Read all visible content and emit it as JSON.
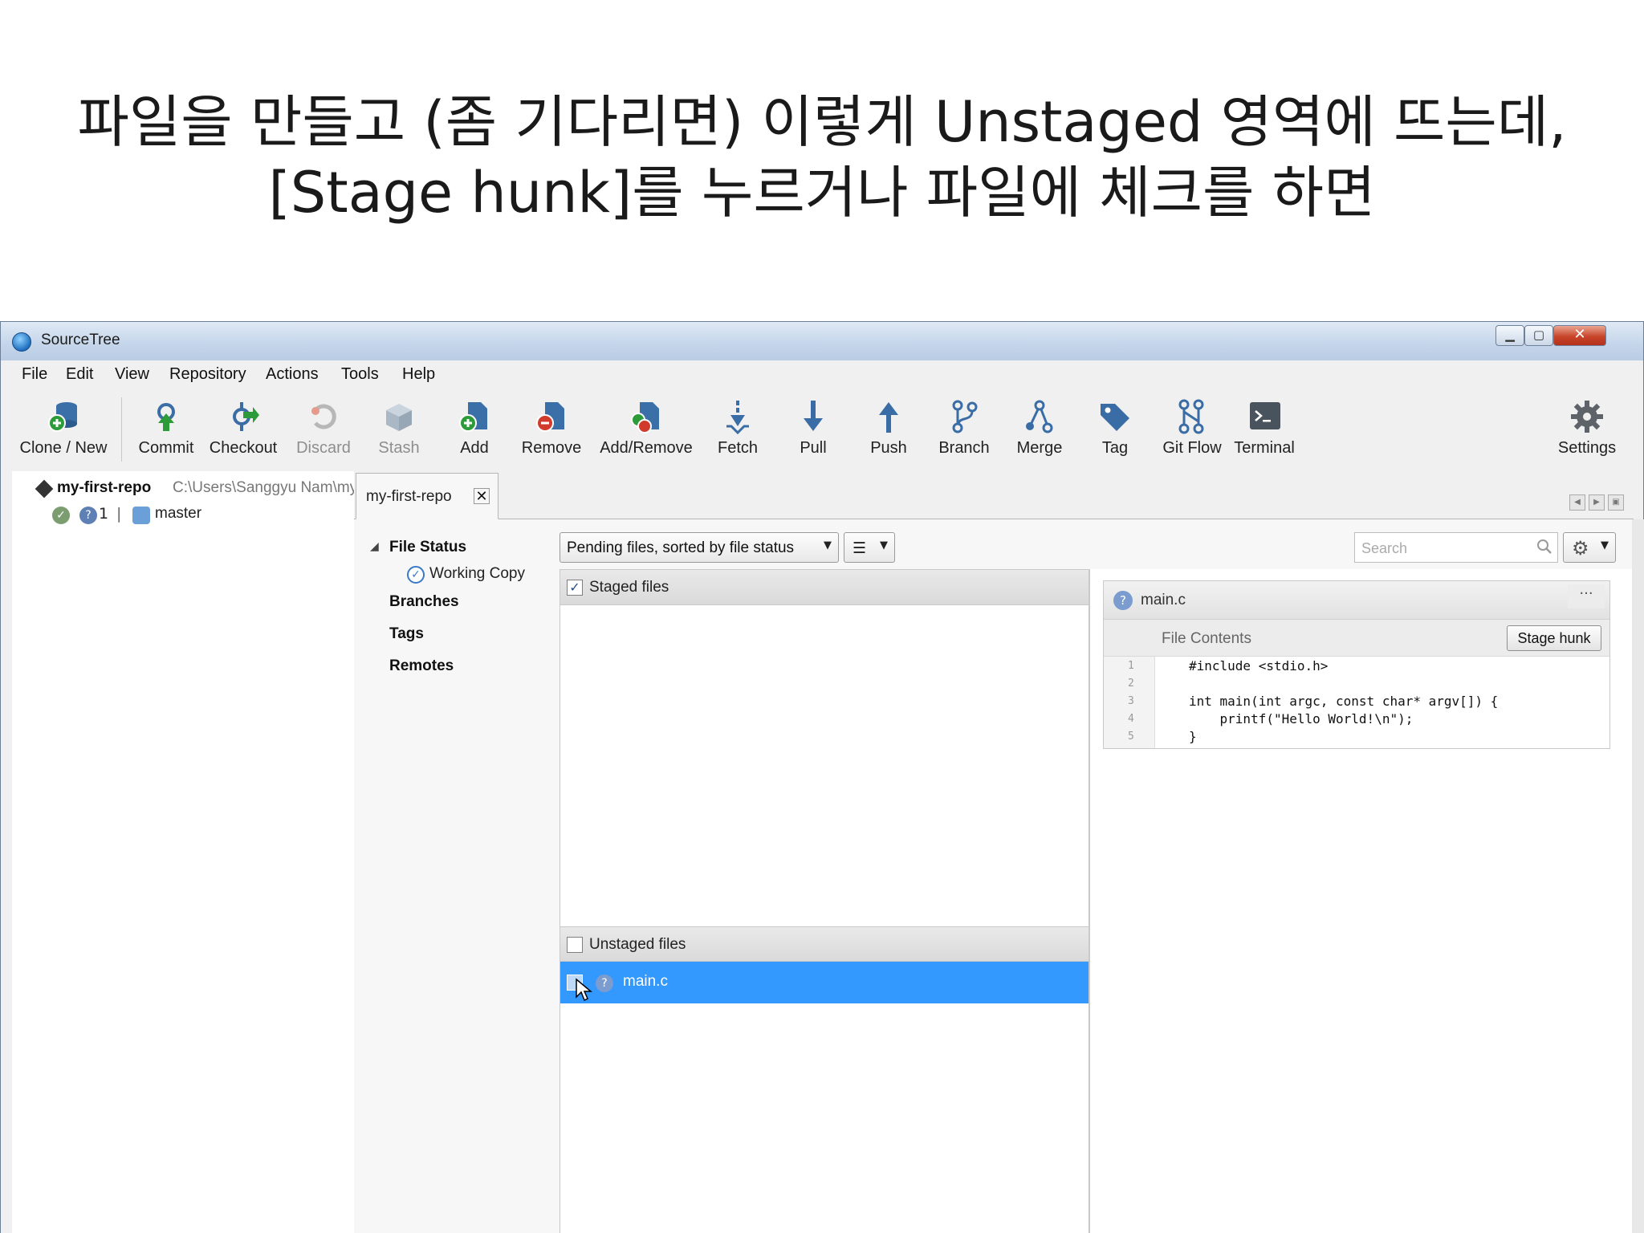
{
  "caption": {
    "line1": "파일을 만들고 (좀 기다리면) 이렇게 Unstaged 영역에 뜨는데,",
    "line2": "[Stage hunk]를 누르거나 파일에 체크를 하면"
  },
  "window": {
    "title": "SourceTree",
    "min_symbol": "▁",
    "max_symbol": "▢",
    "close_symbol": "✕"
  },
  "menu": [
    "File",
    "Edit",
    "View",
    "Repository",
    "Actions",
    "Tools",
    "Help"
  ],
  "toolbar": {
    "clone": "Clone / New",
    "commit": "Commit",
    "checkout": "Checkout",
    "discard": "Discard",
    "stash": "Stash",
    "add": "Add",
    "remove": "Remove",
    "addremove": "Add/Remove",
    "fetch": "Fetch",
    "pull": "Pull",
    "push": "Push",
    "branch": "Branch",
    "merge": "Merge",
    "tag": "Tag",
    "gitflow": "Git Flow",
    "terminal": "Terminal",
    "settings": "Settings"
  },
  "repo": {
    "name": "my-first-repo",
    "path": "C:\\Users\\Sanggyu Nam\\my-first-repo",
    "pending_count": "1",
    "separator": "|",
    "branch": "master"
  },
  "tab": {
    "label": "my-first-repo",
    "close": "✕"
  },
  "nav": {
    "file_status": "File Status",
    "working_copy": "Working Copy",
    "branches": "Branches",
    "tags": "Tags",
    "remotes": "Remotes"
  },
  "filter": {
    "sort_label": "Pending files, sorted by file status",
    "search_placeholder": "Search"
  },
  "staged": {
    "title": "Staged files",
    "checked_mark": "✓"
  },
  "unstaged": {
    "title": "Unstaged files",
    "files": [
      {
        "name": "main.c",
        "status": "?"
      }
    ]
  },
  "diff": {
    "file": "main.c",
    "more": "...",
    "hunk_title": "File Contents",
    "stage_hunk": "Stage hunk",
    "lines": [
      {
        "n": "1",
        "text": "#include <stdio.h>"
      },
      {
        "n": "2",
        "text": ""
      },
      {
        "n": "3",
        "text": "int main(int argc, const char* argv[]) {"
      },
      {
        "n": "4",
        "text": "    printf(\"Hello World!\\n\");"
      },
      {
        "n": "5",
        "text": "}"
      }
    ]
  },
  "colors": {
    "selection": "#3399ff",
    "accent_green": "#2e9b3a",
    "accent_red": "#d13b2b",
    "accent_blue": "#3a73b8"
  }
}
